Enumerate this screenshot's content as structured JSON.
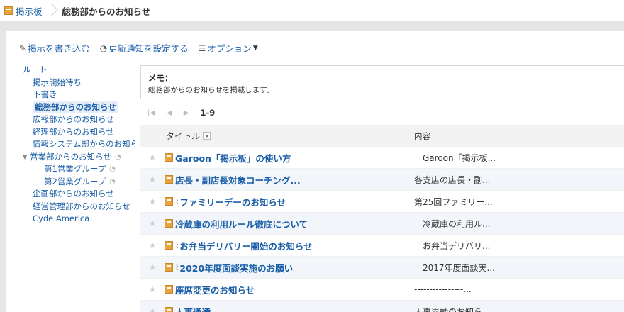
{
  "breadcrumb": {
    "root": "掲示板",
    "current": "総務部からのお知らせ"
  },
  "toolbar": {
    "write": "掲示を書き込む",
    "notify": "更新通知を設定する",
    "options": "オプション"
  },
  "tree": {
    "root": "ルート",
    "items": [
      {
        "label": "掲示開始待ち",
        "level": 1
      },
      {
        "label": "下書き",
        "level": 1
      },
      {
        "label": "総務部からのお知らせ",
        "level": 1,
        "selected": true
      },
      {
        "label": "広報部からのお知らせ",
        "level": 1
      },
      {
        "label": "経理部からのお知らせ",
        "level": 1
      },
      {
        "label": "情報システム部からのお知らせ",
        "level": 1
      },
      {
        "label": "営業部からのお知らせ",
        "level": 1,
        "toggle": true,
        "rss": true
      },
      {
        "label": "第1営業グループ",
        "level": 2,
        "rss": true
      },
      {
        "label": "第2営業グループ",
        "level": 2,
        "rss": true
      },
      {
        "label": "企画部からのお知らせ",
        "level": 1
      },
      {
        "label": "経営管理部からのお知らせ",
        "level": 1
      },
      {
        "label": "Cyde America",
        "level": 1
      }
    ]
  },
  "memo": {
    "label": "メモ：",
    "text": "総務部からのお知らせを掲載します。"
  },
  "pager": {
    "range": "1-9"
  },
  "table": {
    "headers": {
      "title": "タイトル",
      "content": "内容"
    },
    "rows": [
      {
        "title": "Garoon「掲示板」の使い方",
        "content": "Garoon「掲示板...",
        "clip": false,
        "indent": true
      },
      {
        "title": "店長・副店長対象コーチング...",
        "content": "各支店の店長・副...",
        "clip": false,
        "indent": false
      },
      {
        "title": "ファミリーデーのお知らせ",
        "content": "第25回ファミリー...",
        "clip": true,
        "indent": false
      },
      {
        "title": "冷蔵庫の利用ルール徹底について",
        "content": "冷蔵庫の利用ル...",
        "clip": false,
        "indent": true
      },
      {
        "title": "お弁当デリバリー開始のお知らせ",
        "content": "お弁当デリバリ...",
        "clip": true,
        "indent": true
      },
      {
        "title": "2020年度面談実施のお願い",
        "content": "2017年度面談実...",
        "clip": true,
        "indent": true
      },
      {
        "title": "座席変更のお知らせ",
        "content": "----------------...",
        "clip": false,
        "indent": false
      },
      {
        "title": "人事通達",
        "content": "人事異動のお知ら...",
        "clip": false,
        "indent": false
      }
    ]
  }
}
